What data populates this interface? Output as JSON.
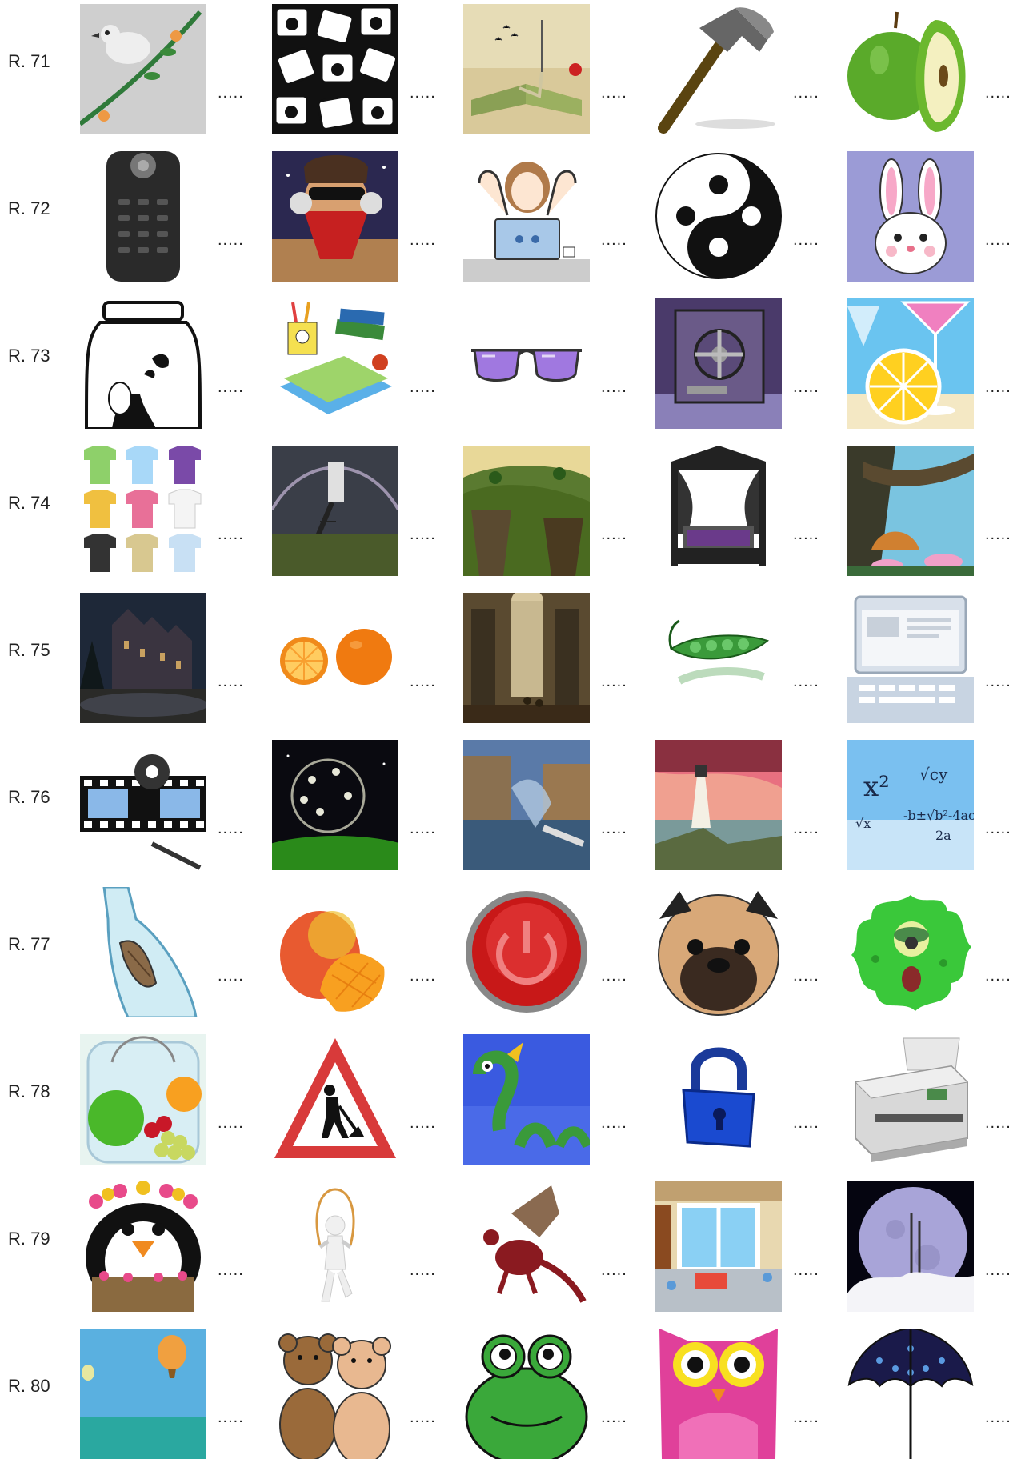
{
  "rows": [
    {
      "label": "R. 71",
      "items": [
        {
          "icon": "bird-on-branch-icon",
          "blank": "....."
        },
        {
          "icon": "camera-pattern-icon",
          "blank": "....."
        },
        {
          "icon": "open-book-landscape-icon",
          "blank": "....."
        },
        {
          "icon": "hammer-icon",
          "blank": "....."
        },
        {
          "icon": "green-apple-icon",
          "blank": "....."
        }
      ]
    },
    {
      "label": "R. 72",
      "items": [
        {
          "icon": "remote-control-icon",
          "blank": "....."
        },
        {
          "icon": "bandana-headphones-man-icon",
          "blank": "....."
        },
        {
          "icon": "girl-at-laptop-icon",
          "blank": "....."
        },
        {
          "icon": "yin-yang-icon",
          "blank": "....."
        },
        {
          "icon": "bunny-face-icon",
          "blank": "....."
        }
      ]
    },
    {
      "label": "R. 73",
      "items": [
        {
          "icon": "fairy-jar-icon",
          "blank": "....."
        },
        {
          "icon": "school-supplies-icon",
          "blank": "....."
        },
        {
          "icon": "purple-sunglasses-icon",
          "blank": "....."
        },
        {
          "icon": "bank-vault-icon",
          "blank": "....."
        },
        {
          "icon": "cocktail-lemon-icon",
          "blank": "....."
        }
      ]
    },
    {
      "label": "R. 74",
      "items": [
        {
          "icon": "tshirts-grid-icon",
          "blank": "....."
        },
        {
          "icon": "door-in-field-icon",
          "blank": "....."
        },
        {
          "icon": "green-cliff-landscape-icon",
          "blank": "....."
        },
        {
          "icon": "gothic-canopy-bed-icon",
          "blank": "....."
        },
        {
          "icon": "lotus-fantasy-icon",
          "blank": "....."
        }
      ]
    },
    {
      "label": "R. 75",
      "items": [
        {
          "icon": "haunted-castle-icon",
          "blank": "....."
        },
        {
          "icon": "oranges-icon",
          "blank": "....."
        },
        {
          "icon": "church-interior-painting-icon",
          "blank": "....."
        },
        {
          "icon": "pea-pod-icon",
          "blank": "....."
        },
        {
          "icon": "laptop-icon",
          "blank": "....."
        }
      ]
    },
    {
      "label": "R. 76",
      "items": [
        {
          "icon": "film-projector-icon",
          "blank": "....."
        },
        {
          "icon": "flower-globe-space-icon",
          "blank": "....."
        },
        {
          "icon": "surreal-city-canal-icon",
          "blank": "....."
        },
        {
          "icon": "lighthouse-sunset-icon",
          "blank": "....."
        },
        {
          "icon": "math-formulas-icon",
          "blank": "....."
        }
      ]
    },
    {
      "label": "R. 77",
      "items": [
        {
          "icon": "message-in-bottle-icon",
          "blank": "....."
        },
        {
          "icon": "mango-icon",
          "blank": "....."
        },
        {
          "icon": "power-button-icon",
          "blank": "....."
        },
        {
          "icon": "pug-face-icon",
          "blank": "....."
        },
        {
          "icon": "green-germ-monster-icon",
          "blank": "....."
        }
      ]
    },
    {
      "label": "R. 78",
      "items": [
        {
          "icon": "fruit-on-scale-icon",
          "blank": "....."
        },
        {
          "icon": "roadwork-sign-icon",
          "blank": "....."
        },
        {
          "icon": "sea-serpent-icon",
          "blank": "....."
        },
        {
          "icon": "padlock-icon",
          "blank": "....."
        },
        {
          "icon": "printer-scanner-icon",
          "blank": "....."
        }
      ]
    },
    {
      "label": "R. 79",
      "items": [
        {
          "icon": "hula-penguin-icon",
          "blank": "....."
        },
        {
          "icon": "jump-rope-figure-icon",
          "blank": "....."
        },
        {
          "icon": "red-dragon-icon",
          "blank": "....."
        },
        {
          "icon": "window-room-interior-icon",
          "blank": "....."
        },
        {
          "icon": "moon-clouds-icon",
          "blank": "....."
        }
      ]
    },
    {
      "label": "R. 80",
      "items": [
        {
          "icon": "hot-air-balloons-icon",
          "blank": "....."
        },
        {
          "icon": "teddy-bears-icon",
          "blank": "....."
        },
        {
          "icon": "frog-face-icon",
          "blank": "....."
        },
        {
          "icon": "pink-owl-icon",
          "blank": "....."
        },
        {
          "icon": "umbrella-icon",
          "blank": "....."
        }
      ]
    }
  ]
}
